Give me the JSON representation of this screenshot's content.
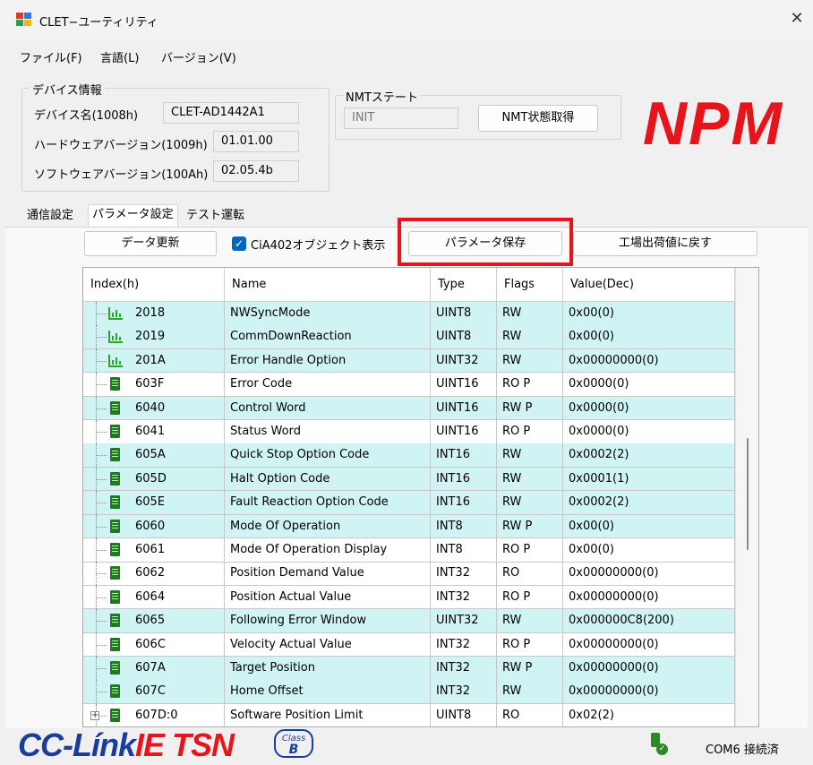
{
  "window": {
    "title": "CLET−ユーティリティ",
    "close_glyph": "✕"
  },
  "menu": [
    "ファイル(F)",
    "言語(L)",
    "バージョン(V)"
  ],
  "device_info": {
    "title": "デバイス情報",
    "name_label": "デバイス名(1008h)",
    "name_value": "CLET-AD1442A1",
    "hw_label": "ハードウェアバージョン(1009h)",
    "hw_value": "01.01.00",
    "sw_label": "ソフトウェアバージョン(100Ah)",
    "sw_value": "02.05.4b"
  },
  "nmt": {
    "title": "NMTステート",
    "state": "INIT",
    "button": "NMT状態取得"
  },
  "logo": "NPM",
  "tabs": [
    "通信設定",
    "パラメータ設定",
    "テスト運転"
  ],
  "toolbar": {
    "refresh": "データ更新",
    "checkbox_label": "CiA402オブジェクト表示",
    "checkbox_checked": true,
    "save": "パラメータ保存",
    "reset": "工場出荷値に戻す"
  },
  "table": {
    "headers": [
      "Index(h)",
      "Name",
      "Type",
      "Flags",
      "Value(Dec)"
    ],
    "rows": [
      {
        "icon": "chart",
        "index": "2018",
        "name": "NWSyncMode",
        "type": "UINT8",
        "flags": "RW",
        "value": "0x00(0)",
        "teal": true
      },
      {
        "icon": "chart",
        "index": "2019",
        "name": "CommDownReaction",
        "type": "UINT8",
        "flags": "RW",
        "value": "0x00(0)",
        "teal": true
      },
      {
        "icon": "chart",
        "index": "201A",
        "name": "Error Handle Option",
        "type": "UINT32",
        "flags": "RW",
        "value": "0x00000000(0)",
        "teal": true
      },
      {
        "icon": "doc",
        "index": "603F",
        "name": "Error Code",
        "type": "UINT16",
        "flags": "RO P",
        "value": "0x0000(0)",
        "teal": false
      },
      {
        "icon": "doc",
        "index": "6040",
        "name": "Control Word",
        "type": "UINT16",
        "flags": "RW P",
        "value": "0x0000(0)",
        "teal": true
      },
      {
        "icon": "doc",
        "index": "6041",
        "name": "Status Word",
        "type": "UINT16",
        "flags": "RO P",
        "value": "0x0000(0)",
        "teal": false
      },
      {
        "icon": "doc",
        "index": "605A",
        "name": "Quick Stop Option Code",
        "type": "INT16",
        "flags": "RW",
        "value": "0x0002(2)",
        "teal": true
      },
      {
        "icon": "doc",
        "index": "605D",
        "name": "Halt Option Code",
        "type": "INT16",
        "flags": "RW",
        "value": "0x0001(1)",
        "teal": true
      },
      {
        "icon": "doc",
        "index": "605E",
        "name": "Fault Reaction Option Code",
        "type": "INT16",
        "flags": "RW",
        "value": "0x0002(2)",
        "teal": true
      },
      {
        "icon": "doc",
        "index": "6060",
        "name": "Mode Of Operation",
        "type": "INT8",
        "flags": "RW P",
        "value": "0x00(0)",
        "teal": true
      },
      {
        "icon": "doc",
        "index": "6061",
        "name": "Mode Of Operation Display",
        "type": "INT8",
        "flags": "RO P",
        "value": "0x00(0)",
        "teal": false
      },
      {
        "icon": "doc",
        "index": "6062",
        "name": "Position Demand Value",
        "type": "INT32",
        "flags": "RO",
        "value": "0x00000000(0)",
        "teal": false
      },
      {
        "icon": "doc",
        "index": "6064",
        "name": "Position Actual Value",
        "type": "INT32",
        "flags": "RO P",
        "value": "0x00000000(0)",
        "teal": false
      },
      {
        "icon": "doc",
        "index": "6065",
        "name": "Following Error Window",
        "type": "UINT32",
        "flags": "RW",
        "value": "0x000000C8(200)",
        "teal": true
      },
      {
        "icon": "doc",
        "index": "606C",
        "name": "Velocity Actual Value",
        "type": "INT32",
        "flags": "RO P",
        "value": "0x00000000(0)",
        "teal": false
      },
      {
        "icon": "doc",
        "index": "607A",
        "name": "Target Position",
        "type": "INT32",
        "flags": "RW P",
        "value": "0x00000000(0)",
        "teal": true
      },
      {
        "icon": "doc",
        "index": "607C",
        "name": "Home Offset",
        "type": "INT32",
        "flags": "RW",
        "value": "0x00000000(0)",
        "teal": true
      },
      {
        "icon": "doc",
        "index": "607D:0",
        "name": "Software Position Limit",
        "type": "UINT8",
        "flags": "RO",
        "value": "0x02(2)",
        "teal": false,
        "expandable": true
      }
    ]
  },
  "footer": {
    "logo_part1": "CC-Línk",
    "logo_part2": "IE TSN",
    "badge_line1": "Class",
    "badge_line2": "B",
    "status": "COM6 接続済"
  },
  "colors": {
    "teal_row": "#d0f3f4",
    "logo_red": "#e8141b",
    "cc_blue": "#1a3c9c",
    "highlight": "#e8141b"
  }
}
